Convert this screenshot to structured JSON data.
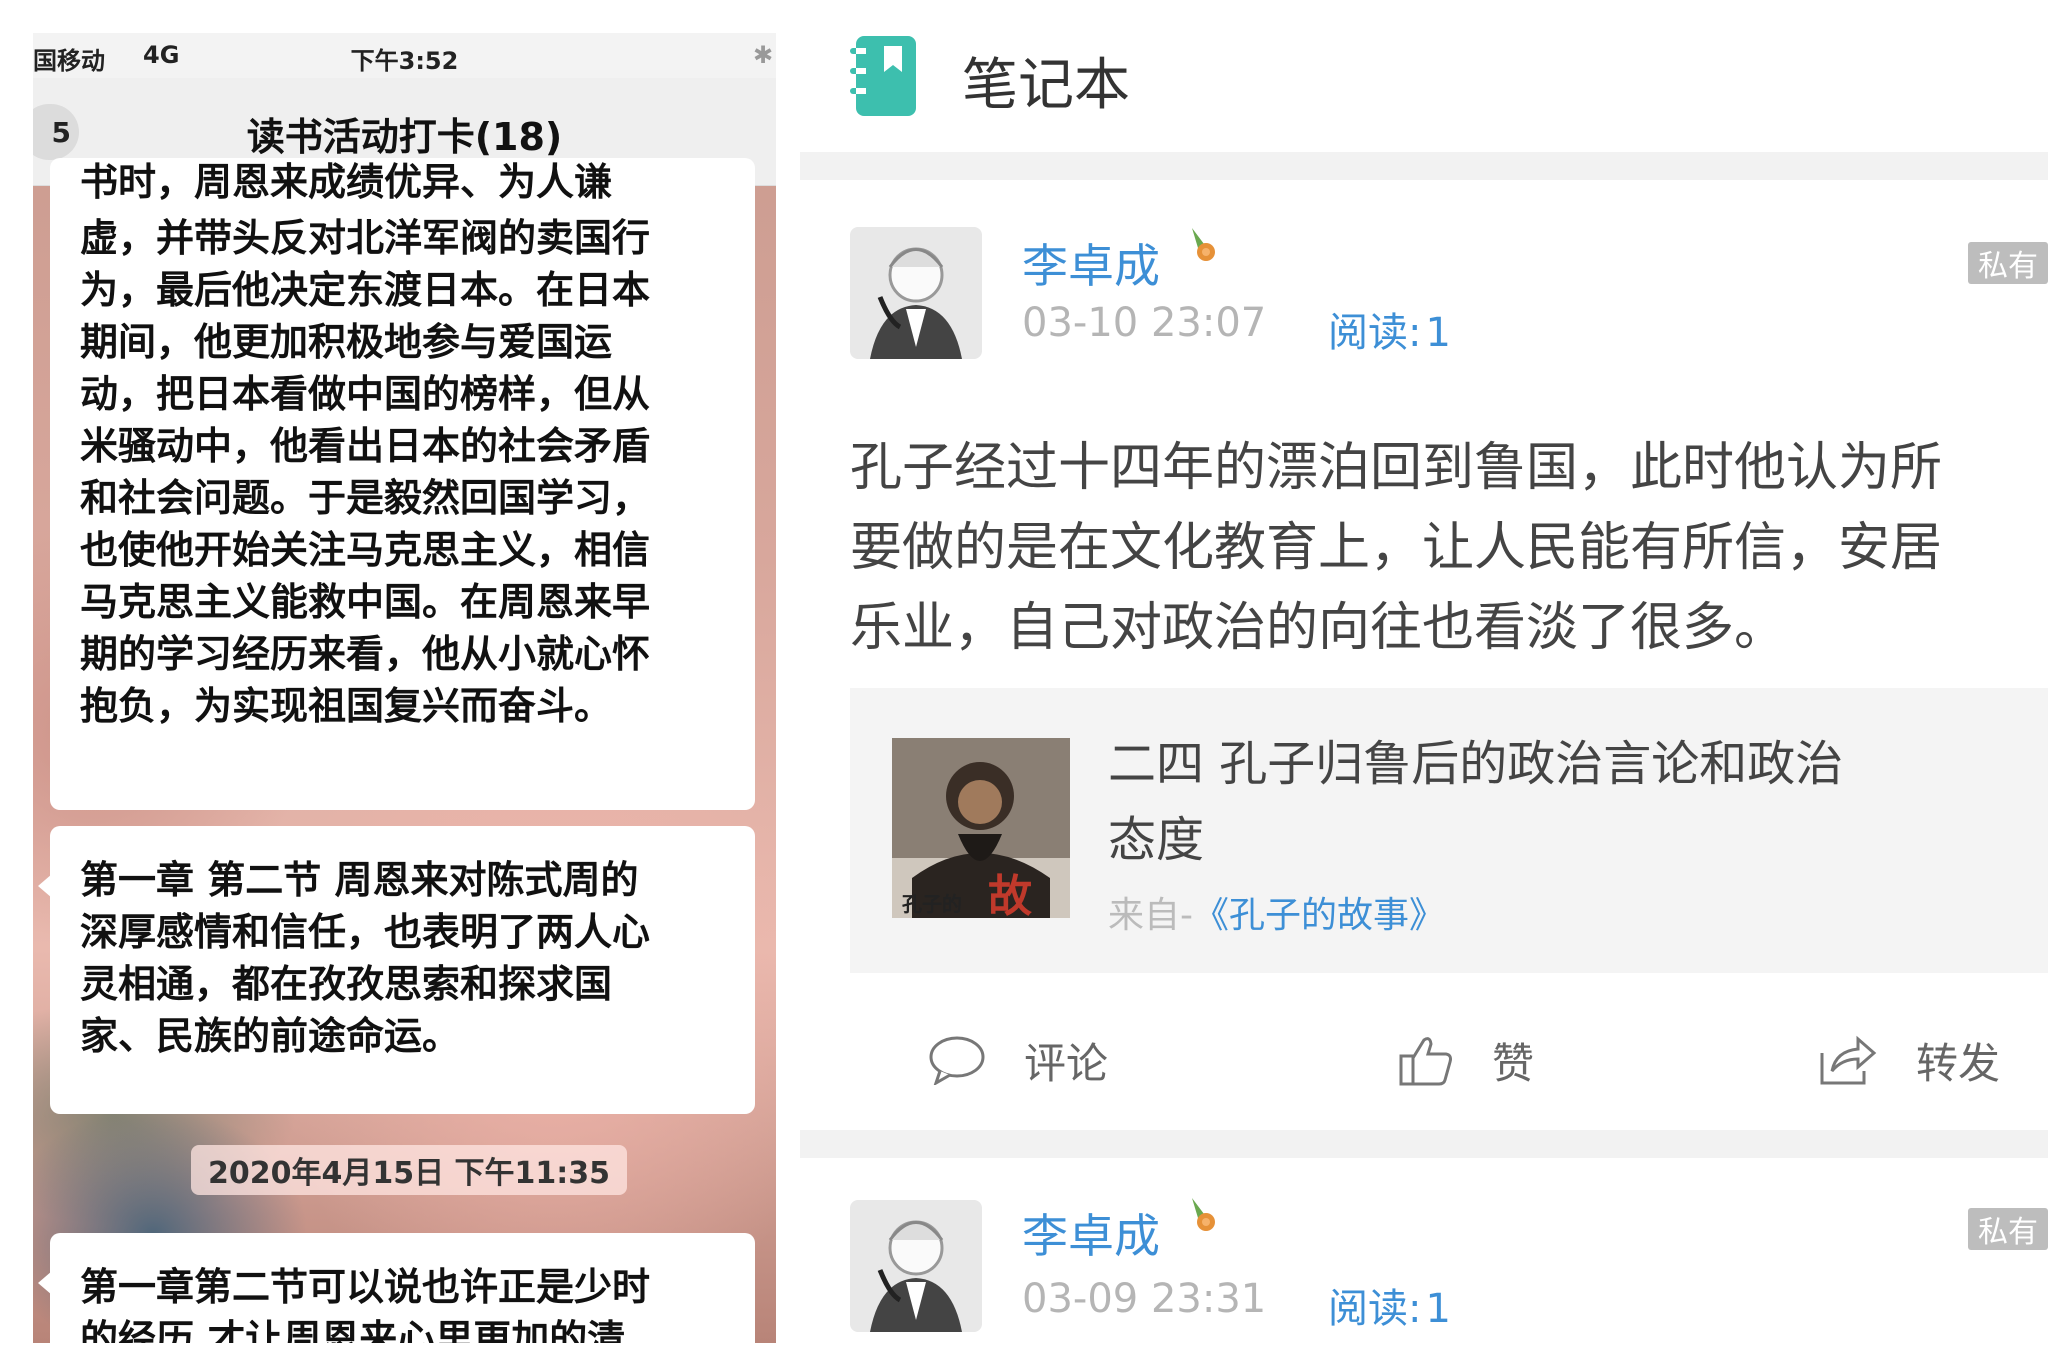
{
  "chat": {
    "status": {
      "carrier": "国移动",
      "network": "4G",
      "time": "下午3:52",
      "bluetooth": "✱"
    },
    "header": {
      "back_count": "5",
      "title": "读书活动打卡(18)"
    },
    "messages": [
      {
        "lines": [
          "书时，周恩来成绩优异、为人谦",
          "虚，并带头反对北洋军阀的卖国行",
          "为，最后他决定东渡日本。在日本",
          "期间，他更加积极地参与爱国运",
          "动，把日本看做中国的榜样，但从",
          "米骚动中，他看出日本的社会矛盾",
          "和社会问题。于是毅然回国学习，",
          "也使他开始关注马克思主义，相信",
          "马克思主义能救中国。在周恩来早",
          "期的学习经历来看，他从小就心怀",
          "抱负，为实现祖国复兴而奋斗。"
        ]
      },
      {
        "lines": [
          "第一章  第二节 周恩来对陈式周的",
          "深厚感情和信任，也表明了两人心",
          "灵相通，都在孜孜思索和探求国",
          "家、民族的前途命运。"
        ]
      },
      {
        "lines": [
          "第一章第二节可以说也许正是少时",
          "的经历 才让周恩来心里更加的清"
        ]
      }
    ],
    "timestamp": "2020年4月15日 下午11:35"
  },
  "notebook": {
    "title": "笔记本",
    "colors": {
      "accent": "#3d8fd6",
      "icon": "#3dbfae"
    },
    "notes": [
      {
        "user": "李卓成",
        "time": "03-10 23:07",
        "reads_label": "阅读:",
        "reads": "1",
        "privacy": "私有",
        "text": [
          "孔子经过十四年的漂泊回到鲁国，此时他认为所",
          "要做的是在文化教育上，让人民能有所信，安居",
          "乐业，自己对政治的向往也看淡了很多。"
        ],
        "book": {
          "chapter": [
            "二四  孔子归鲁后的政治言论和政治",
            "态度"
          ],
          "source_prefix": "来自-",
          "source_title": "《孔子的故事》",
          "cover_text_small": "孔子的",
          "cover_text_big": "故事"
        },
        "actions": {
          "comment": "评论",
          "like": "赞",
          "share": "转发"
        }
      },
      {
        "user": "李卓成",
        "time": "03-09 23:31",
        "reads_label": "阅读:",
        "reads": "1",
        "privacy": "私有"
      }
    ]
  }
}
